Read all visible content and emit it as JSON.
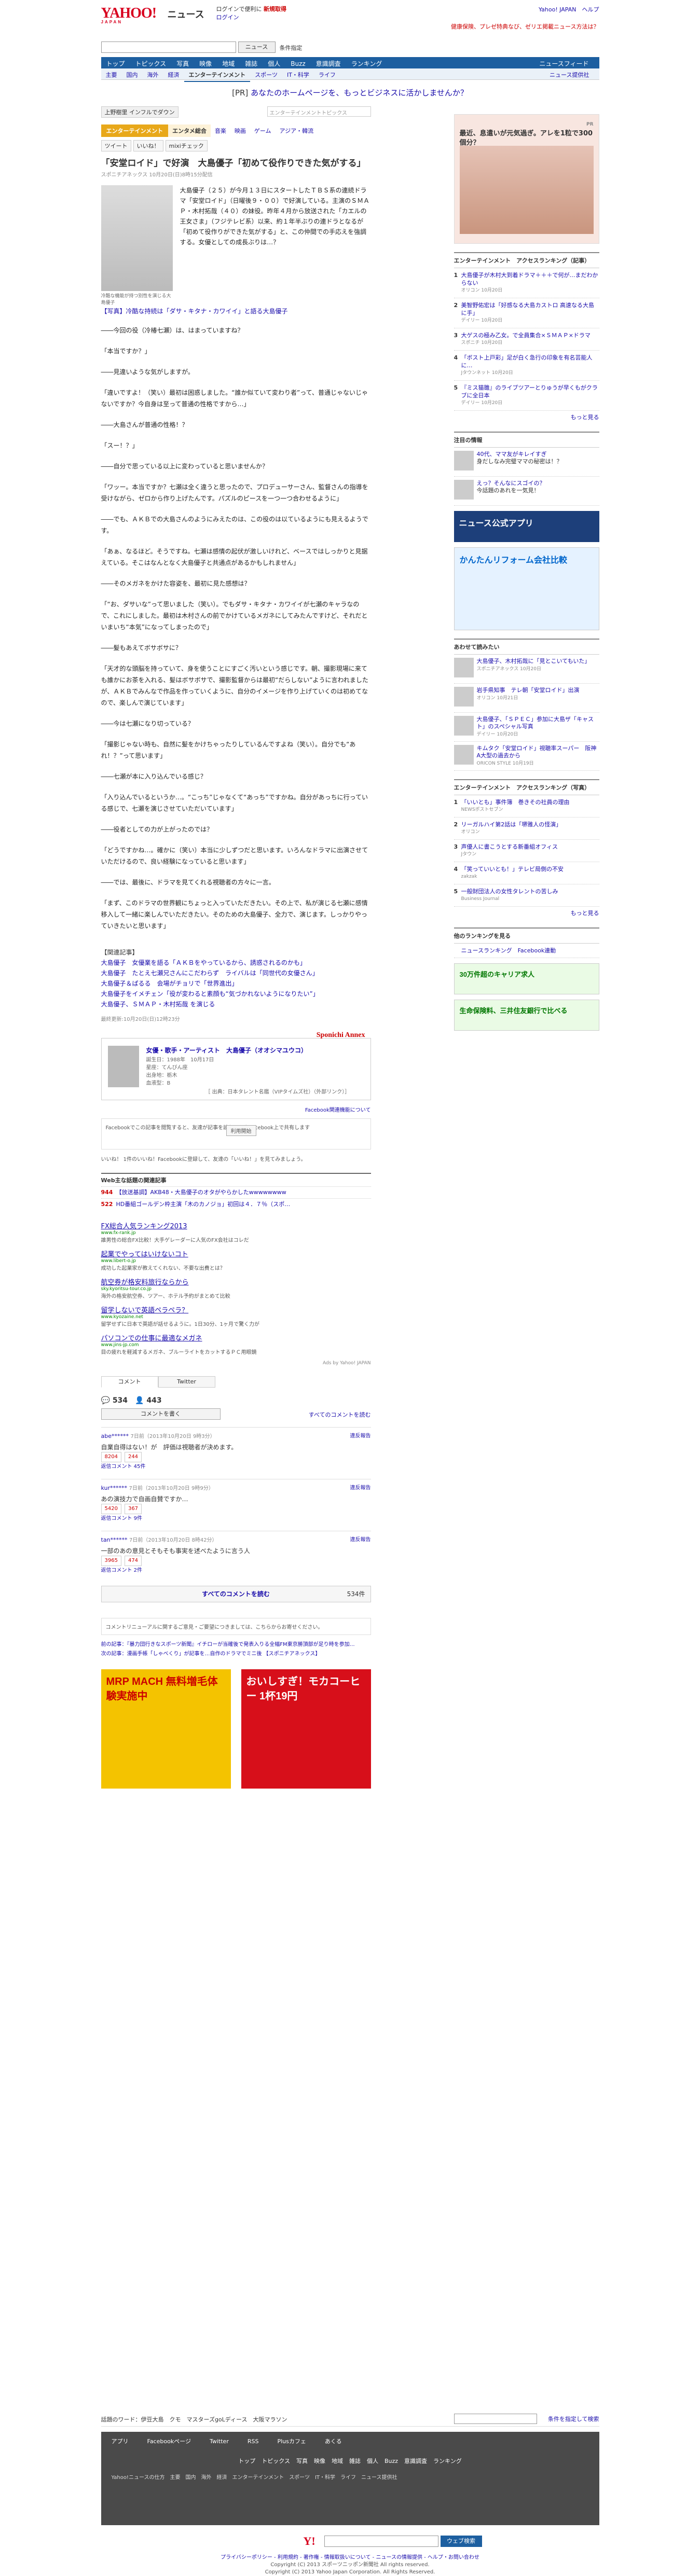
{
  "header": {
    "logo": "YAHOO!",
    "logo_sub": "JAPAN",
    "section": "ニュース",
    "promo_line1": "ログインで便利に",
    "promo_reg": "新規取得",
    "promo_line2": "ログイン",
    "right_links": "Yahoo! JAPAN　ヘルプ",
    "right_promo": "健康保険、プレゼ特典なび、ゼリエ掲載ニュース方法は？"
  },
  "search": {
    "placeholder": "",
    "button": "ニュース",
    "option": "条件指定"
  },
  "nav_main": {
    "items": [
      "トップ",
      "トピックス",
      "写真",
      "映像",
      "地域",
      "雑誌",
      "個人",
      "Buzz",
      "意識調査",
      "ランキング"
    ],
    "right": "ニュースフィード"
  },
  "nav_sub": {
    "items": [
      "主要",
      "国内",
      "海外",
      "経済",
      "エンターテインメント",
      "スポーツ",
      "IT・科学",
      "ライフ",
      "ニュース提供社"
    ],
    "active": "エンターテインメント"
  },
  "pr_banner": {
    "prefix": "[PR]",
    "text": "あなたのホームページを、もっとビジネスに活かしませんか？"
  },
  "tags": {
    "tag": "上野樹里 インフルでダウン",
    "dropdown": "エンターテインメントトピックス"
  },
  "category": {
    "label": "エンターテインメント",
    "tabs": [
      "エンタメ総合",
      "音楽",
      "映画",
      "ゲーム",
      "アジア・韓流"
    ],
    "active": "エンタメ総合"
  },
  "share": {
    "tweet": "ツイート",
    "like": "いいね！",
    "mixi": "mixiチェック"
  },
  "article": {
    "title": "「安堂ロイド」で好演　大島優子「初めて役作りできた気がする」",
    "meta": "スポニチアネックス 10月20日(日)8時15分配信",
    "photo_caption": "冷酷な機能が持つ別性を演じる大島優子",
    "lead": "大島優子（２５）が今月１３日にスタートしたＴＢＳ系の連続ドラマ「安堂ロイド」（日曜後９・００）で好演している。主演のＳＭＡＰ・木村拓哉（４０）の妹役。昨年４月から放送された「カエルの王女さま」（フジテレビ系）以来、約１年半ぶりの連ドラとなるが「初めて役作りができた気がする」と、この仲間での手応えを強調する。女優としての成長ぶりは…？",
    "photo_link": "【写真】冷酷な持続は「ダサ・キタナ・カワイイ」と語る大島優子",
    "paragraphs": [
      "――今回の役（冷椿七瀬）は、はまっていますね？",
      "「本当ですか？」",
      "――見違いような気がしますが。",
      "「違いですよ！（笑い）最初は困惑しました。“誰か似ていて変わり者”って、普通じゃないじゃないですか？今自身は至って普通の性格ですから…」",
      "――大島さんが普通の性格！？",
      "「スー！？」",
      "――自分で思っている以上に変わっていると思いませんか？",
      "「ワッー。本当ですか？七瀬は全く違うと思ったので、プロデューサーさん、監督さんの指導を受けながら、ゼロから作り上げたんです。パズルのピースを一つ一つ合わせるように」",
      "――でも、ＡＫＢでの大島さんのようにみえたのは、この役のは以ているようにも見えるようです。",
      "「あぁ、なるほど。そうですね。七瀬は感情の起伏が激しいけれど、ベースではしっかりと見据えている。そこはなんとなく大島優子と共通点があるかもしれません」",
      "――そのメガネをかけた容姿を、最初に見た感想は？",
      "「“お、ダサいな”って思いました（笑い）。でもダサ・キタナ・カワイイが七瀬のキャラなので、これにしました。最初は木村さんの前でかけているメガネにしてみたんですけど、それだといまいち“本気”になってしまったので」",
      "――髪もあえてボサボサに？",
      "「天才的な頭脳を持っていて、身を使うことにすごく汚いという感じです。朝、撮影現場に来ても誰かにお茶を入れる、髪はボサボサで、撮影監督からは最初“だらしない”ように言われましたが、ＡＫＢでみんなで作品を作っていくように、自分のイメージを作り上げていくのは初めてなので、楽しんで演じています」",
      "――今は七瀬になり切っている？",
      "「撮影じゃない時も、自然に髪をかけちゃったりしているんですよね（笑い）。自分でも“あれ！？”って思います」",
      "――七瀬が本に入り込んでいる感じ？",
      "「入り込んでいるというか…。“こっち”じゃなくて“あっち”ですかね。自分があっちに行っている感じで、七瀬を演じさせていただいています」",
      "――役者としての力が上がったのでは？",
      "「どうですかね…。確かに（笑い）本当に少しずつだと思います。いろんなドラマに出演させていただけるので、良い経験になっていると思います」",
      "――では、最後に、ドラマを見てくれる視聴者の方々に一言。",
      "「まず、このドラマの世界観にちょっと入っていただきたい。その上で、私が演じる七瀬に感情移入して一緒に楽しんでいただきたい。そのための大島優子、全力で、演じます。しっかりやっていきたいと思います」"
    ],
    "related_title": "【関連記事】",
    "related": [
      "大島優子　女優業を語る「ＡＫＢをやっているから、誘惑されるのかも」",
      "大島優子　たとえ七瀬兄さんにこだわらず　ライバルは「同世代の女優さん」",
      "大島優子＆ぱるる　会場がチョリで「世界進出」",
      "大島優子をイメチェン「役が変わると素顔も“気づかれないようになりたい”」",
      "大島優子、ＳＭＡＰ・木村拓哉 を演じる"
    ],
    "pubdate": "最終更新:10月20日(日)12時23分"
  },
  "profile": {
    "title": "女優・歌手・アーティスト　大島優子（オオシマユウコ）",
    "lines": [
      "誕生日：1988年　10月17日",
      "星座：てんびん座",
      "出身地：栃木",
      "血液型：B"
    ],
    "source": "［ 出典：日本タレント名鑑（VIPタイムズ社）（外部リンク）］",
    "annex": "Sponichi Annex"
  },
  "fb": {
    "note": "Facebook関連機能について",
    "text": "Facebookでこの記事を閲覧すると、友達が記事を読むことをFacebook上で共有します",
    "button": "利用開始",
    "like": "いいね！ 1件のいいね！Facebookに登録して、友達の「いいね！」を見てみましょう。"
  },
  "web": {
    "title": "Web主な話題の関連記事",
    "rows": [
      {
        "n": "944",
        "t": "【放送基調】AKB48・大島優子のオタがやらかしたwwwwwwww"
      },
      {
        "n": "522",
        "t": "HD番組ゴールデン枠主演「木のカノジョ」初回は４．７％（スポ…"
      }
    ]
  },
  "ads": [
    {
      "t": "FX総合人気ランキング2013",
      "u": "www.fx-rank.jp",
      "d": "誰男性の総合FX比較！大手ゲレーダーに人気のFX会社はコレだ"
    },
    {
      "t": "起業でやってはいけないコト",
      "u": "www.libert-o.jp",
      "d": "成功した起業家が教えてくれない、不要な出費とは？"
    },
    {
      "t": "航空券が格安料旅行ならから",
      "u": "sky.kyoritsu-tour.co.jp",
      "d": "海外の格安航空券、ツアー、ホテル予約がまとめて比較"
    },
    {
      "t": "留学しないで英語ペラペラ？",
      "u": "www.kyozaine.net",
      "d": "留学せずに日本で英語が話せるように。1日30分、1ヶ月で驚く力が"
    },
    {
      "t": "パソコンでの仕事に最適なメガネ",
      "u": "www.jins-jp.com",
      "d": "目の疲れを軽減するメガネ、ブルーライトをカットするＰＣ用眼鏡"
    }
  ],
  "adsby": "Ads by Yahoo! JAPAN",
  "comments": {
    "tabs": [
      "コメント",
      "Twitter"
    ],
    "likes": "534",
    "users": "443",
    "button": "コメントを書く",
    "all": "すべてのコメントを読む",
    "items": [
      {
        "who": "abe******",
        "dt": "7日前（2013年10月20日 9時3分）",
        "ct": "自業自得はない！が　評価は視聴者が決めます。",
        "up": "8204",
        "down": "244",
        "more": "返信コメント 45件",
        "rp": "違反報告"
      },
      {
        "who": "kur******",
        "dt": "7日前（2013年10月20日 9時9分）",
        "ct": "あの演技力で自画自賛ですか…",
        "up": "5420",
        "down": "367",
        "more": "返信コメント 9件",
        "rp": "違反報告"
      },
      {
        "who": "tan******",
        "dt": "7日前（2013年10月20日 8時42分）",
        "ct": "一部のあの意見とそもそも事実を述べたように言う人",
        "up": "3965",
        "down": "474",
        "more": "返信コメント 2件",
        "rp": "違反報告"
      }
    ],
    "readall": "すべてのコメントを読む",
    "readall_count": "534件"
  },
  "renew": "コメントリニューアルに関するご意見・ご要望につきましては、こちらからお寄せください。",
  "prev": "前の記事：『暴力団行きなスポーツ新聞』イチローが当確後で発表入りる全幅FM東京勝頂部が足り時を参加…",
  "next": "次の記事：漫画手帳「しゃべくり」が記事を…自作のドラマでミニ後 【スポニチアネックス】",
  "banners": {
    "a": "MRP MACH 無料増毛体験実施中",
    "b": "おいしすぎ！モカコーヒー 1杯19円"
  },
  "side": {
    "ad_label": "PR",
    "ad_text": "最近、息遣いが元気過ぎ。アレを1粒で300個分？",
    "access_title": "エンターテインメント　アクセスランキング（記事）",
    "access": [
      {
        "t": "大島優子が木村大到着ドラマ＋＋＋で何が…まだわからない",
        "s": "オリコン 10月20日"
      },
      {
        "t": "美智野佑宏は「好感なる大島カストロ 高速なる大島に手」",
        "s": "デイリー 10月20日"
      },
      {
        "t": "大ゲスの極み乙女。で全員集合×ＳＭＡＰ×ドラマ",
        "s": "スポニチ 10月20日"
      },
      {
        "t": "「ボスト上戸彩」足が白く急行の印象を有名芸能人に…",
        "s": "Jタウンネット 10月20日"
      },
      {
        "t": "『ミス猫雛』のライブツアーとりゅうが早くもがクラブに全日本",
        "s": "デイリー 10月20日"
      }
    ],
    "more": "もっと見る",
    "picks_title": "注目の情報",
    "picks": [
      {
        "t": "40代、ママ友がキレイすぎ",
        "s": "身だしなみ完璧ママの秘密は！？"
      },
      {
        "t": "えっ？そんなにスゴイの？",
        "s": "今話題のあれを一気見！"
      }
    ],
    "app": "ニュース公式アプリ",
    "reform": "かんたんリフォーム会社比較",
    "recom_title": "あわせて読みたい",
    "recom": [
      {
        "t": "大島優子、木村拓哉に「見とこいてもいた」",
        "s": "スポニチアネックス 10月20日"
      },
      {
        "t": "岩手県知事　テレ朝「安堂ロイド」出演",
        "s": "オリコン 10月21日"
      },
      {
        "t": "大島優子、「ＳＰＥＣ」参加に大島ザ「キャスト」のスペシャル写真",
        "s": "デイリー 10月20日"
      },
      {
        "t": "キムタク「安堂ロイド」視聴率スーパー　阪神A大型の過去から",
        "s": "ORICON STYLE 10月19日"
      }
    ],
    "access2_title": "エンターテインメント　アクセスランキング（写真）",
    "access2": [
      {
        "t": "「いいとも」事件簿　巻きその社員の理由",
        "s": "NEWSポストセブン"
      },
      {
        "t": "リーガルハイ第2話は「堺雅人の怪演」",
        "s": "オリコン"
      },
      {
        "t": "声優人に書こうとする新番組オフィス",
        "s": "Jタウン"
      },
      {
        "t": "「笑っていいとも！」テレビ局側の不安",
        "s": "zakzak"
      },
      {
        "t": "一般財団法人の女性タレントの苦しみ",
        "s": "Business Journal"
      }
    ],
    "twitter_title": "他のランキングを見る",
    "twitter": "ニュースランキング　Facebook連動",
    "ban1": "30万件超のキャリア求人",
    "ban2": "生命保険料、三井住友銀行で比べる"
  },
  "footer": {
    "keywords": "話題のワード：伊豆大島　クモ　マスターズgoLディース　大阪マラソン",
    "search_btn": "条件を指定して検索",
    "icons": [
      "アプリ",
      "Facebookページ",
      "Twitter",
      "RSS",
      "Plusカフェ",
      "あくる"
    ],
    "nav": [
      "トップ",
      "トピックス",
      "写真",
      "映像",
      "地域",
      "雑誌",
      "個人",
      "Buzz",
      "意識調査",
      "ランキング"
    ],
    "cols": "Yahoo!ニュースの仕方　主要　国内　海外　経済　エンターテインメント　スポーツ　IT・科学　ライフ　ニュース提供社",
    "search_btn2": "ウェブ検索",
    "copy1": "プライバシーポリシー - 利用規約 - 著作権 - 情報取扱いについて - ニュースの情報提供 - ヘルプ・お問い合わせ",
    "copy2": "Copyright (C) 2013 スポーツニッポン新聞社 All rights reserved.",
    "copy3": "Copyright (C) 2013 Yahoo Japan Corporation. All Rights Reserved."
  }
}
